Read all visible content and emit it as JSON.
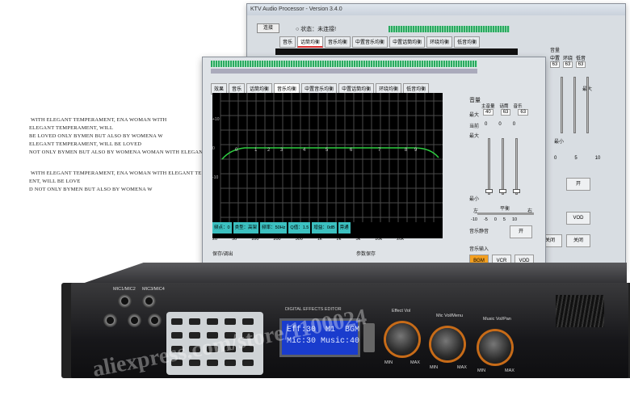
{
  "back_window": {
    "title": "KTV Audio Processor - Version 3.4.0",
    "connect_label": "连接",
    "status_text": "状态：未连接!",
    "tabs": [
      "音乐",
      "话筒均衡",
      "音乐均衡",
      "中置音乐均衡",
      "中置话筒均衡",
      "环绕均衡",
      "低音均衡"
    ],
    "active_tab": 1,
    "volume_label": "音量",
    "col_labels": [
      "中置",
      "环绕",
      "低音"
    ],
    "values": [
      "63",
      "63",
      "63"
    ],
    "max_label": "最大",
    "min_label": "最小",
    "scale": [
      "0",
      "5",
      "10"
    ],
    "buttons": [
      "开",
      "VOD",
      "关闭",
      "关闭"
    ]
  },
  "front_window": {
    "tabs": [
      "效果",
      "音乐",
      "话筒均衡",
      "音乐均衡",
      "中置音乐均衡",
      "中置话筒均衡",
      "环绕均衡",
      "低音均衡"
    ],
    "active_tab": 3,
    "volume_label": "音量",
    "max_label": "最大",
    "current_label": "当前",
    "min_label": "最小",
    "fader_cols": [
      "主音量",
      "话筒",
      "音乐"
    ],
    "fader_max_values": [
      "40",
      "63",
      "63"
    ],
    "fader_current_values": [
      "0",
      "0",
      "0"
    ],
    "balance_label": "平衡",
    "balance_left": "左",
    "balance_right": "右",
    "balance_scale": [
      "-10",
      "-5",
      "0",
      "5",
      "10"
    ],
    "mute_label": "音乐静音",
    "mute_on": "开",
    "music_input_label": "音乐输入",
    "input_buttons": [
      "BGM",
      "VCR",
      "VOD"
    ],
    "save_label": "保存/调出",
    "param_save_label": "参数保存",
    "eq_y_labels": [
      "+10",
      "0",
      "-10"
    ],
    "eq_point_labels": [
      "0",
      "1",
      "2",
      "3",
      "4",
      "5",
      "6",
      "7",
      "8",
      "9"
    ],
    "eq_x_labels": [
      "20",
      "50",
      "100",
      "200",
      "500",
      "1k",
      "2k",
      "5k",
      "10k",
      "20k"
    ],
    "params": [
      "频点：0",
      "类型：高架",
      "频率：50Hz",
      "Q值：1.5",
      "增益：0dB",
      "旁通"
    ]
  },
  "side_text": [
    "with elegant temperament, ena woman with",
    "elegant temperament, will",
    "be loved only bymen but also by womena w",
    "elegant temperament, will be loved",
    "not only bymen but also by womena woman with elegant temper",
    "with elegant temperament, ena woman with elegant temperam",
    "ent, will be love",
    "d not only bymen but also by womena w"
  ],
  "device": {
    "top_label": "DIGITAL EFFECTS EDITOR",
    "lcd_line1": "Eff:30  M1  BGM",
    "lcd_line2": "Mic:30 Music:40",
    "knob_labels": [
      "Effect Vol",
      "Mic Vol/Menu",
      "Music Vol/Pan"
    ],
    "min_label": "MIN",
    "max_label": "MAX",
    "jack_labels": [
      "MIC1/MIC2",
      "MIC3/MIC4"
    ]
  },
  "watermark": "aliexpress.com/store/1100024",
  "colors": {
    "meter_green": "#2aa860",
    "lcd_blue": "#1a3ccd",
    "knob_ring": "#c76b18",
    "param_cyan": "#3cc0c0"
  }
}
